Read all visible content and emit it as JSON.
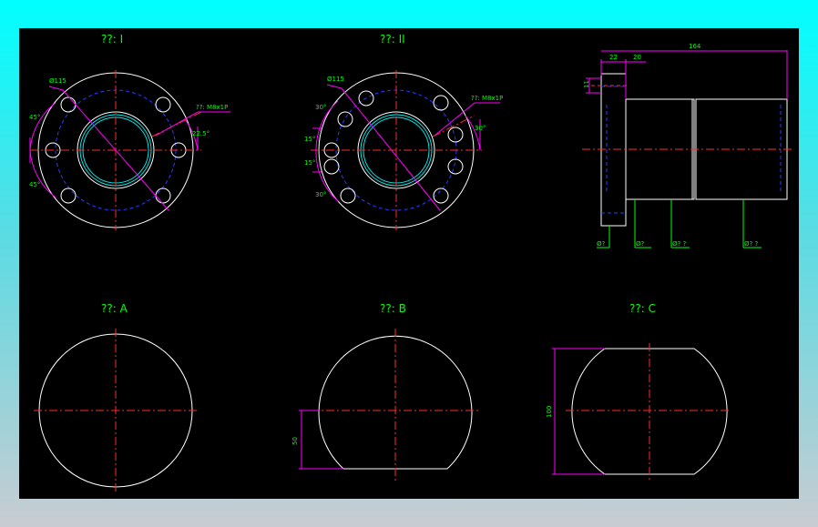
{
  "views": {
    "I": {
      "title": "??: I",
      "dia": "Ø115",
      "thread": "??: M8x1P",
      "angles": [
        "45°",
        "45°",
        "22.5°"
      ]
    },
    "II": {
      "title": "??: II",
      "dia": "Ø115",
      "thread": "??: M8x1P",
      "angles": [
        "30°",
        "15°",
        "15°",
        "30°",
        "30°"
      ]
    },
    "A": {
      "title": "??: A"
    },
    "B": {
      "title": "??: B",
      "dim": "50"
    },
    "C": {
      "title": "??: C",
      "dim": "100"
    }
  },
  "side": {
    "dims": [
      "22",
      "20",
      "164",
      "11"
    ],
    "callouts": [
      "Ø?",
      "Ø?",
      "Ø? ?",
      "Ø? ?"
    ]
  }
}
